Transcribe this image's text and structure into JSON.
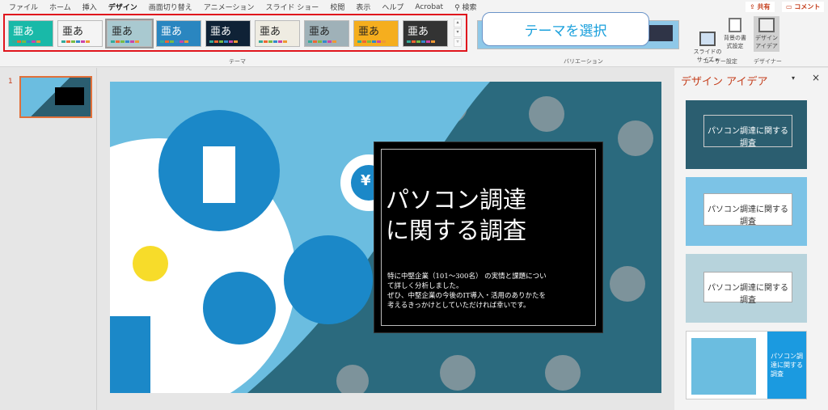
{
  "tabs": [
    "ファイル",
    "ホーム",
    "挿入",
    "デザイン",
    "画面切り替え",
    "アニメーション",
    "スライド ショー",
    "校閲",
    "表示",
    "ヘルプ",
    "Acrobat",
    "検索"
  ],
  "active_tab": "デザイン",
  "share": "共有",
  "comment": "コメント",
  "themes": [
    {
      "label": "亜あ",
      "bg": "#19b9a8",
      "fg": "#fff"
    },
    {
      "label": "亜あ",
      "bg": "#f4f4f4",
      "fg": "#222"
    },
    {
      "label": "亜あ",
      "bg": "#a9c9d0",
      "fg": "#222"
    },
    {
      "label": "亜あ",
      "bg": "#2a86c0",
      "fg": "#fff"
    },
    {
      "label": "亜あ",
      "bg": "#0f2236",
      "fg": "#fff"
    },
    {
      "label": "亜あ",
      "bg": "#efece2",
      "fg": "#222"
    },
    {
      "label": "亜あ",
      "bg": "#9fb1b8",
      "fg": "#222"
    },
    {
      "label": "亜あ",
      "bg": "#f5ae1e",
      "fg": "#222"
    },
    {
      "label": "亜あ",
      "bg": "#333",
      "fg": "#fff"
    }
  ],
  "groups": {
    "theme": "テーマ",
    "variation": "バリエーション",
    "user": "ユーザー設定",
    "designer": "デザイナー"
  },
  "callout": "テーマを選択",
  "buttons": {
    "slide_size": "スライドの サイズ ▾",
    "bg_format": "背景の書 式設定",
    "design_ideas": "デザイン アイデア"
  },
  "slide_number": "1",
  "slide": {
    "title1": "パソコン調達",
    "title2": "に関する調査",
    "body": [
      "特に中堅企業（101～300名） の実情と課題につい",
      "て詳しく分析しました。",
      "ぜひ、中堅企業の今後のIT導入・活用のありかたを",
      "考えるきっかけとしていただければ幸いです。"
    ],
    "yen": "¥"
  },
  "pane": {
    "title": "デザイン アイデア",
    "ideas": [
      "パソコン調達に関する調査",
      "パソコン調達に関する調査",
      "パソコン調達に関する調査",
      "パソコン調達に関する調査"
    ]
  }
}
